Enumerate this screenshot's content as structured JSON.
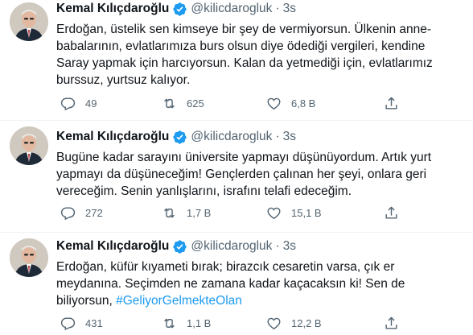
{
  "tweets": [
    {
      "author": "Kemal Kılıçdaroğlu",
      "handle": "@kilicdarogluk",
      "separator": "·",
      "time": "3s",
      "lines": [
        "Erdoğan, üstelik sen kimseye bir şey de vermiyorsun. Ülkenin anne-",
        "babalarının, evlatlarımıza burs olsun diye ödediği vergileri, kendine",
        "Saray yapmak için harcıyorsun. Kalan da yetmediği için, evlatlarımız",
        "burssuz, yurtsuz kalıyor."
      ],
      "replies": "49",
      "retweets": "625",
      "likes": "6,8 B"
    },
    {
      "author": "Kemal Kılıçdaroğlu",
      "handle": "@kilicdarogluk",
      "separator": "·",
      "time": "3s",
      "lines": [
        "Bugüne kadar sarayını üniversite yapmayı düşünüyordum. Artık yurt",
        "yapmayı da düşüneceğim! Gençlerden çalınan her şeyi, onlara geri",
        "vereceğim. Senin yanlışlarını, israfını telafi edeceğim."
      ],
      "replies": "272",
      "retweets": "1,7 B",
      "likes": "15,1 B"
    },
    {
      "author": "Kemal Kılıçdaroğlu",
      "handle": "@kilicdarogluk",
      "separator": "·",
      "time": "3s",
      "lines": [
        "Erdoğan, küfür kıyameti bırak; birazcık cesaretin varsa, çık er",
        "meydanına. Seçimden ne zamana kadar kaçacaksın ki! Sen de",
        "biliyorsun, "
      ],
      "hashtag": "#GeliyorGelmekteOlan",
      "replies": "431",
      "retweets": "1,1 B",
      "likes": "12,2 B"
    }
  ],
  "icons": {
    "reply": "reply-icon",
    "retweet": "retweet-icon",
    "like": "heart-icon",
    "share": "share-icon",
    "verified": "verified-badge-icon"
  },
  "colors": {
    "text": "#0f1419",
    "secondary": "#536471",
    "accent": "#1d9bf0",
    "divider": "#eff3f4"
  }
}
